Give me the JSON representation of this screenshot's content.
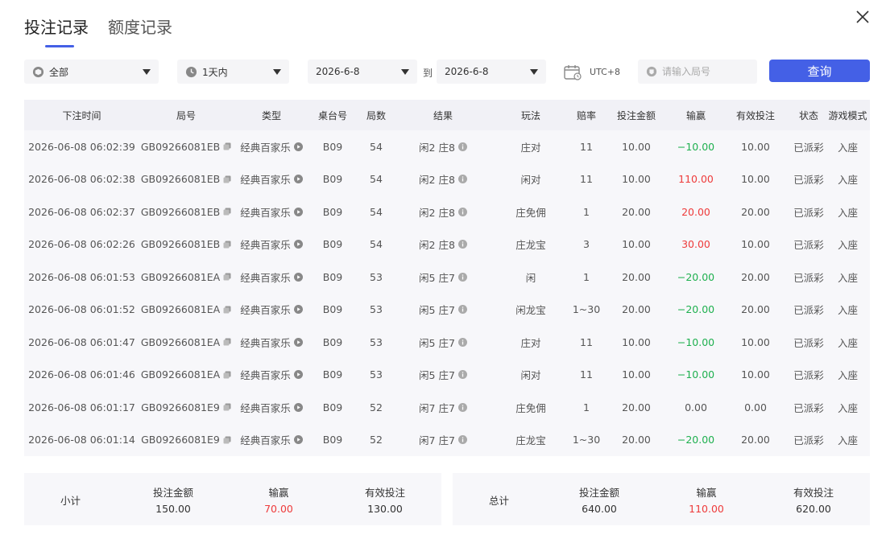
{
  "tabs": [
    "投注记录",
    "额度记录"
  ],
  "filters": {
    "category": "全部",
    "range": "1天内",
    "date_from": "2026-6-8",
    "to_label": "到",
    "date_to": "2026-6-8",
    "timezone": "UTC+8",
    "round_placeholder": "请输入局号",
    "query_label": "查询"
  },
  "columns": [
    "下注时间",
    "局号",
    "类型",
    "桌台号",
    "局数",
    "结果",
    "玩法",
    "赔率",
    "投注金额",
    "输赢",
    "有效投注",
    "状态",
    "游戏模式"
  ],
  "rows": [
    {
      "time": "2026-06-08 06:02:39",
      "round": "GB09266081EB",
      "type": "经典百家乐",
      "table": "B09",
      "count": "54",
      "result": "闲2 庄8",
      "play": "庄对",
      "odds": "11",
      "bet": "10.00",
      "win": "−10.00",
      "win_sign": "neg",
      "valid": "10.00",
      "status": "已派彩",
      "mode": "入座"
    },
    {
      "time": "2026-06-08 06:02:38",
      "round": "GB09266081EB",
      "type": "经典百家乐",
      "table": "B09",
      "count": "54",
      "result": "闲2 庄8",
      "play": "闲对",
      "odds": "11",
      "bet": "10.00",
      "win": "110.00",
      "win_sign": "pos",
      "valid": "10.00",
      "status": "已派彩",
      "mode": "入座"
    },
    {
      "time": "2026-06-08 06:02:37",
      "round": "GB09266081EB",
      "type": "经典百家乐",
      "table": "B09",
      "count": "54",
      "result": "闲2 庄8",
      "play": "庄免佣",
      "odds": "1",
      "bet": "20.00",
      "win": "20.00",
      "win_sign": "pos",
      "valid": "20.00",
      "status": "已派彩",
      "mode": "入座"
    },
    {
      "time": "2026-06-08 06:02:26",
      "round": "GB09266081EB",
      "type": "经典百家乐",
      "table": "B09",
      "count": "54",
      "result": "闲2 庄8",
      "play": "庄龙宝",
      "odds": "3",
      "bet": "10.00",
      "win": "30.00",
      "win_sign": "pos",
      "valid": "10.00",
      "status": "已派彩",
      "mode": "入座"
    },
    {
      "time": "2026-06-08 06:01:53",
      "round": "GB09266081EA",
      "type": "经典百家乐",
      "table": "B09",
      "count": "53",
      "result": "闲5 庄7",
      "play": "闲",
      "odds": "1",
      "bet": "20.00",
      "win": "−20.00",
      "win_sign": "neg",
      "valid": "20.00",
      "status": "已派彩",
      "mode": "入座"
    },
    {
      "time": "2026-06-08 06:01:52",
      "round": "GB09266081EA",
      "type": "经典百家乐",
      "table": "B09",
      "count": "53",
      "result": "闲5 庄7",
      "play": "闲龙宝",
      "odds": "1~30",
      "bet": "20.00",
      "win": "−20.00",
      "win_sign": "neg",
      "valid": "20.00",
      "status": "已派彩",
      "mode": "入座"
    },
    {
      "time": "2026-06-08 06:01:47",
      "round": "GB09266081EA",
      "type": "经典百家乐",
      "table": "B09",
      "count": "53",
      "result": "闲5 庄7",
      "play": "庄对",
      "odds": "11",
      "bet": "10.00",
      "win": "−10.00",
      "win_sign": "neg",
      "valid": "10.00",
      "status": "已派彩",
      "mode": "入座"
    },
    {
      "time": "2026-06-08 06:01:46",
      "round": "GB09266081EA",
      "type": "经典百家乐",
      "table": "B09",
      "count": "53",
      "result": "闲5 庄7",
      "play": "闲对",
      "odds": "11",
      "bet": "10.00",
      "win": "−10.00",
      "win_sign": "neg",
      "valid": "10.00",
      "status": "已派彩",
      "mode": "入座"
    },
    {
      "time": "2026-06-08 06:01:17",
      "round": "GB09266081E9",
      "type": "经典百家乐",
      "table": "B09",
      "count": "52",
      "result": "闲7 庄7",
      "play": "庄免佣",
      "odds": "1",
      "bet": "20.00",
      "win": "0.00",
      "win_sign": "zero",
      "valid": "0.00",
      "status": "已派彩",
      "mode": "入座"
    },
    {
      "time": "2026-06-08 06:01:14",
      "round": "GB09266081E9",
      "type": "经典百家乐",
      "table": "B09",
      "count": "52",
      "result": "闲7 庄7",
      "play": "庄龙宝",
      "odds": "1~30",
      "bet": "20.00",
      "win": "−20.00",
      "win_sign": "neg",
      "valid": "20.00",
      "status": "已派彩",
      "mode": "入座"
    }
  ],
  "subtotal": {
    "label": "小计",
    "bet_label": "投注金额",
    "bet": "150.00",
    "win_label": "输赢",
    "win": "70.00",
    "valid_label": "有效投注",
    "valid": "130.00"
  },
  "total": {
    "label": "总计",
    "bet_label": "投注金额",
    "bet": "640.00",
    "win_label": "输赢",
    "win": "110.00",
    "valid_label": "有效投注",
    "valid": "620.00"
  },
  "colors": {
    "accent": "#4460e6",
    "loss": "#1fb04f",
    "gain": "#ee3b3b"
  }
}
